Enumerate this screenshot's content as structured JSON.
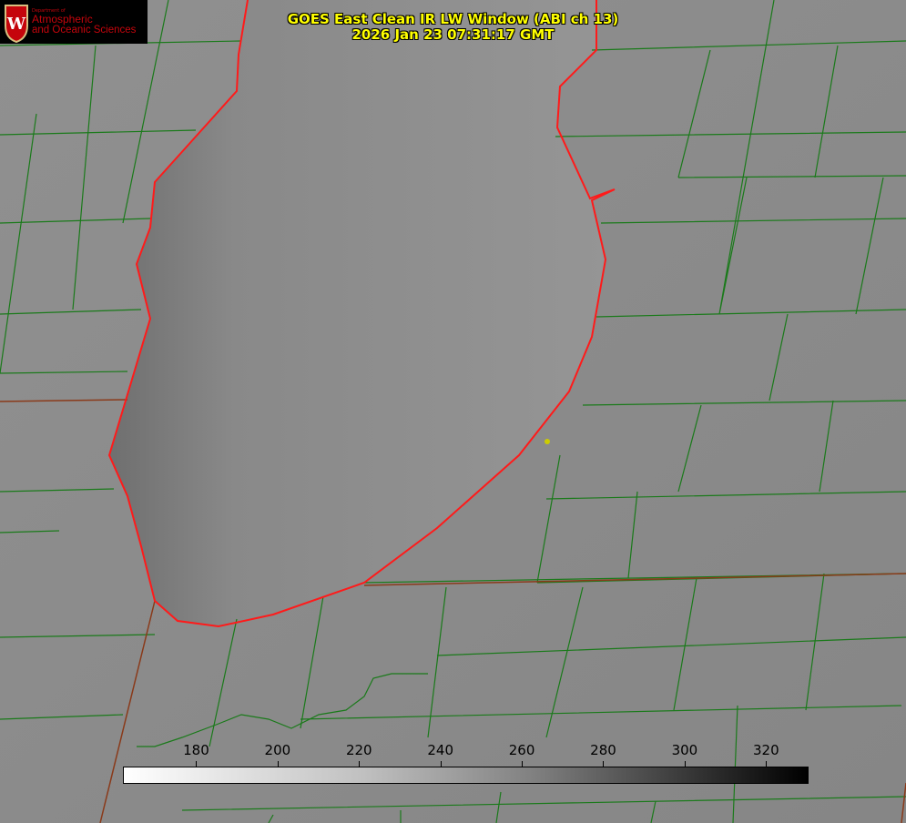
{
  "title": {
    "line1": "GOES East Clean IR LW Window (ABI ch 13)",
    "line2": "2026 Jan 23 07:31:17 GMT"
  },
  "logo": {
    "department": "Department of",
    "line1": "Atmospheric",
    "line2": "and Oceanic Sciences",
    "crest_letter": "W"
  },
  "colorbar": {
    "min": 162,
    "max": 330,
    "ticks": [
      "180",
      "200",
      "220",
      "240",
      "260",
      "280",
      "300",
      "320"
    ],
    "tick_values": [
      180,
      200,
      220,
      240,
      260,
      280,
      300,
      320
    ]
  },
  "colors": {
    "title": "#ffff00",
    "county_lines": "#1a7a1a",
    "coastline": "#ff1a1a",
    "logo_red": "#c5050c"
  }
}
